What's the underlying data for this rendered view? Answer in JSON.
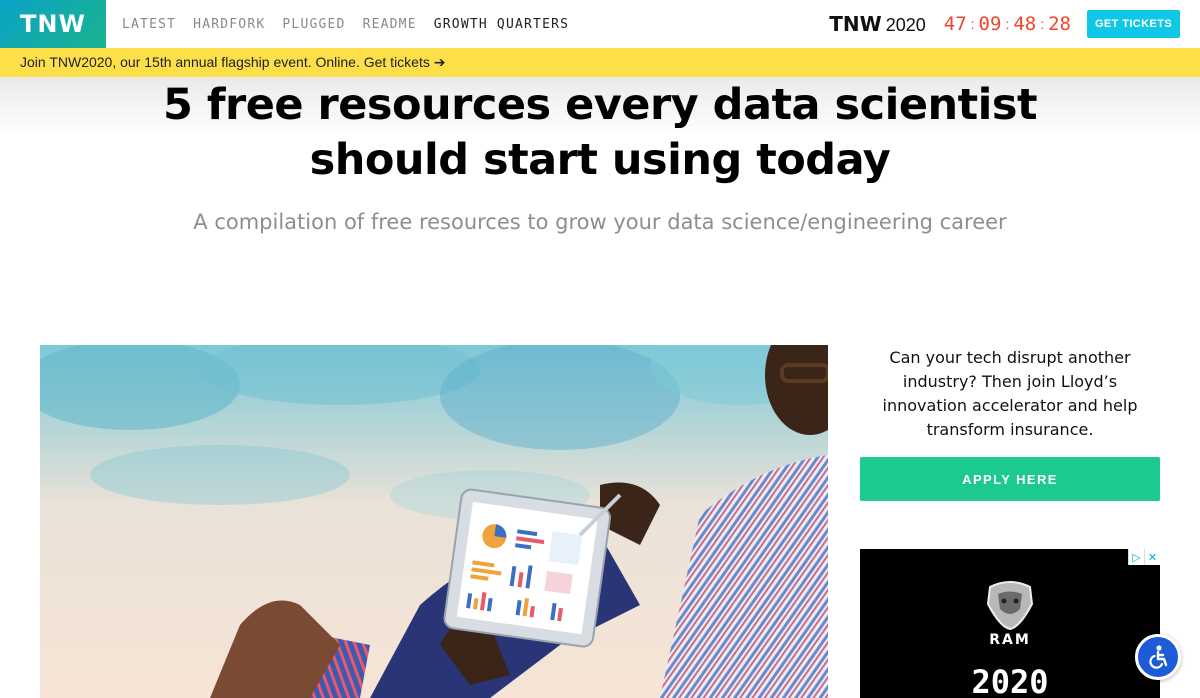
{
  "header": {
    "logo": "TNW",
    "nav": [
      "LATEST",
      "HARDFORK",
      "PLUGGED",
      "README",
      "GROWTH QUARTERS"
    ],
    "event_brand": "TNW",
    "event_year": "2020",
    "countdown": [
      "47",
      "09",
      "48",
      "28"
    ],
    "tickets_label": "GET TICKETS"
  },
  "promo_bar": {
    "text": "Join TNW2020, our 15th annual flagship event. Online. Get tickets ➔"
  },
  "article": {
    "title": "5 free resources every data scientist should start using today",
    "subtitle": "A compilation of free resources to grow your data science/engineering career",
    "hero_image": "person-holding-tablet-with-charts"
  },
  "sidebar": {
    "promo_text": "Can your tech disrupt another industry? Then join Lloyd’s innovation accelerator and help transform insurance.",
    "apply_label": "APPLY HERE",
    "ad": {
      "brand": "RAM",
      "year": "2020",
      "icons": [
        "adchoices-icon",
        "close-icon"
      ]
    }
  },
  "accessibility_button": {
    "icon": "wheelchair-icon"
  },
  "colors": {
    "logo_gradient_start": "#0aa3c6",
    "logo_gradient_end": "#1bb38d",
    "countdown": "#f2452c",
    "tickets_button": "#10c8e5",
    "promo_bar": "#fde049",
    "apply_button": "#1cc98e",
    "accessibility_button": "#1e5bd8"
  }
}
